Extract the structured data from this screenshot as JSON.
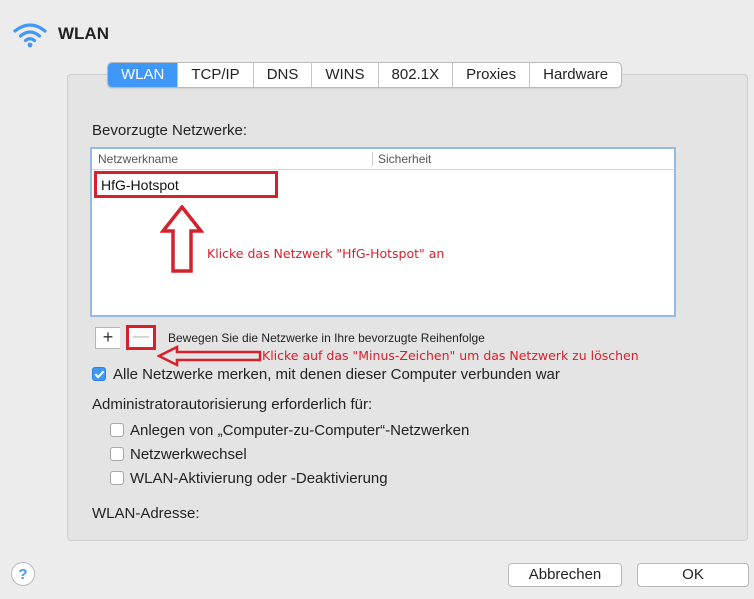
{
  "window": {
    "title": "WLAN",
    "icon": "wifi-icon"
  },
  "tabs": [
    {
      "label": "WLAN",
      "active": true
    },
    {
      "label": "TCP/IP"
    },
    {
      "label": "DNS"
    },
    {
      "label": "WINS"
    },
    {
      "label": "802.1X"
    },
    {
      "label": "Proxies"
    },
    {
      "label": "Hardware"
    }
  ],
  "preferred_networks": {
    "label": "Bevorzugte Netzwerke:",
    "columns": {
      "name": "Netzwerkname",
      "security": "Sicherheit"
    },
    "rows": [
      {
        "name": "HfG-Hotspot",
        "security": ""
      }
    ],
    "add_label": "+",
    "remove_label": "—",
    "reorder_hint": "Bewegen Sie die Netzwerke in Ihre bevorzugte Reihenfolge"
  },
  "annotations": {
    "select_network": "Klicke das Netzwerk \"HfG-Hotspot\" an",
    "click_minus": "Klicke auf das \"Minus-Zeichen\" um das Netzwerk zu löschen",
    "color": "#d6202c"
  },
  "remember_networks": {
    "label": "Alle Netzwerke merken, mit denen dieser Computer verbunden war",
    "checked": true
  },
  "admin_auth": {
    "label": "Administratorautorisierung erforderlich für:",
    "options": [
      {
        "label": "Anlegen von „Computer-zu-Computer“-Netzwerken",
        "checked": false
      },
      {
        "label": "Netzwerkwechsel",
        "checked": false
      },
      {
        "label": "WLAN-Aktivierung oder -Deaktivierung",
        "checked": false
      }
    ]
  },
  "wlan_address": {
    "label": "WLAN-Adresse:"
  },
  "footer": {
    "help_label": "?",
    "cancel_label": "Abbrechen",
    "ok_label": "OK"
  },
  "colors": {
    "accent": "#3f97f7",
    "annotation": "#d6202c"
  }
}
